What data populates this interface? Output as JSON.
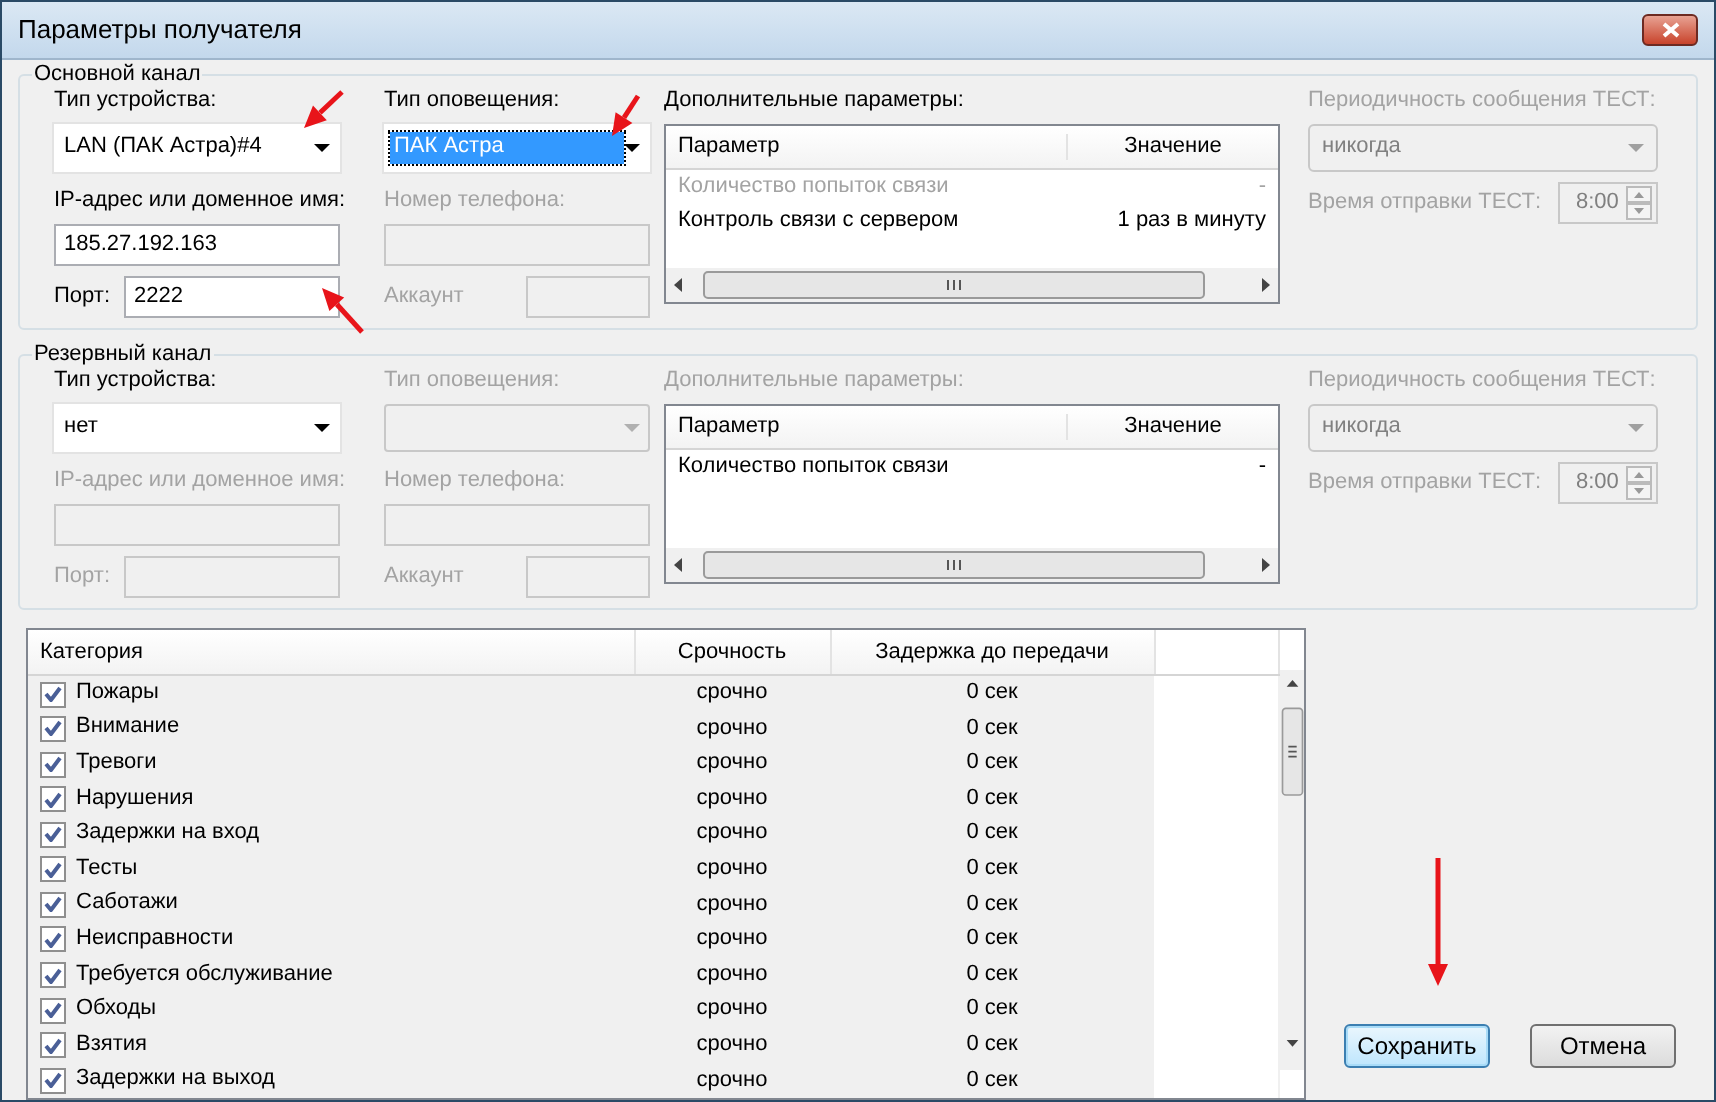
{
  "window": {
    "title": "Параметры получателя"
  },
  "channels": [
    {
      "title": "Основной канал",
      "device_type": {
        "label": "Тип устройства:",
        "value": "LAN (ПАК Астра)#4",
        "disabled": false
      },
      "notify_type": {
        "label": "Тип оповещения:",
        "value": "ПАК Астра",
        "disabled": false,
        "selected": true
      },
      "ip": {
        "label": "IP-адрес или доменное имя:",
        "value": "185.27.192.163",
        "disabled": false
      },
      "phone": {
        "label": "Номер телефона:",
        "disabled": true
      },
      "port": {
        "label": "Порт:",
        "value": "2222",
        "disabled": false
      },
      "account": {
        "label": "Аккаунт",
        "disabled": true
      },
      "extra": {
        "label": "Дополнительные параметры:",
        "disabled": false,
        "columns": [
          "Параметр",
          "Значение"
        ],
        "rows": [
          {
            "param": "Количество попыток связи",
            "value": "-",
            "disabled": true
          },
          {
            "param": "Контроль связи с сервером",
            "value": "1 раз в минуту",
            "disabled": false
          }
        ]
      },
      "test_period": {
        "label": "Периодичность сообщения ТЕСТ:",
        "value": "никогда",
        "disabled": true
      },
      "test_time": {
        "label": "Время отправки ТЕСТ:",
        "value": "8:00",
        "disabled": true
      }
    },
    {
      "title": "Резервный канал",
      "device_type": {
        "label": "Тип устройства:",
        "value": "нет",
        "disabled": false
      },
      "notify_type": {
        "label": "Тип оповещения:",
        "disabled": true,
        "selected": false
      },
      "ip": {
        "label": "IP-адрес или доменное имя:",
        "disabled": true
      },
      "phone": {
        "label": "Номер телефона:",
        "disabled": true
      },
      "port": {
        "label": "Порт:",
        "disabled": true
      },
      "account": {
        "label": "Аккаунт",
        "disabled": true
      },
      "extra": {
        "label": "Дополнительные параметры:",
        "disabled": true,
        "columns": [
          "Параметр",
          "Значение"
        ],
        "rows": [
          {
            "param": "Количество попыток связи",
            "value": "-",
            "disabled": false
          }
        ]
      },
      "test_period": {
        "label": "Периодичность сообщения ТЕСТ:",
        "value": "никогда",
        "disabled": true
      },
      "test_time": {
        "label": "Время отправки ТЕСТ:",
        "value": "8:00",
        "disabled": true
      }
    }
  ],
  "categories": {
    "columns": [
      "Категория",
      "Срочность",
      "Задержка до передачи"
    ],
    "rows": [
      {
        "checked": true,
        "category": "Пожары",
        "urgency": "срочно",
        "delay": "0 сек"
      },
      {
        "checked": true,
        "category": "Внимание",
        "urgency": "срочно",
        "delay": "0 сек"
      },
      {
        "checked": true,
        "category": "Тревоги",
        "urgency": "срочно",
        "delay": "0 сек"
      },
      {
        "checked": true,
        "category": "Нарушения",
        "urgency": "срочно",
        "delay": "0 сек"
      },
      {
        "checked": true,
        "category": "Задержки на вход",
        "urgency": "срочно",
        "delay": "0 сек"
      },
      {
        "checked": true,
        "category": "Тесты",
        "urgency": "срочно",
        "delay": "0 сек"
      },
      {
        "checked": true,
        "category": "Саботажи",
        "urgency": "срочно",
        "delay": "0 сек"
      },
      {
        "checked": true,
        "category": "Неисправности",
        "urgency": "срочно",
        "delay": "0 сек"
      },
      {
        "checked": true,
        "category": "Требуется обслуживание",
        "urgency": "срочно",
        "delay": "0 сек"
      },
      {
        "checked": true,
        "category": "Обходы",
        "urgency": "срочно",
        "delay": "0 сек"
      },
      {
        "checked": true,
        "category": "Взятия",
        "urgency": "срочно",
        "delay": "0 сек"
      },
      {
        "checked": true,
        "category": "Задержки на выход",
        "urgency": "срочно",
        "delay": "0 сек"
      }
    ]
  },
  "buttons": [
    {
      "label": "Сохранить",
      "default": true
    },
    {
      "label": "Отмена",
      "default": false
    }
  ]
}
